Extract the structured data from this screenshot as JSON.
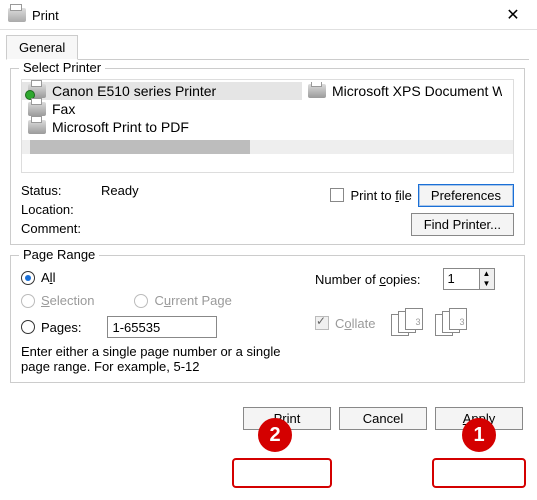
{
  "window": {
    "title": "Print"
  },
  "tabs": {
    "general": "General"
  },
  "select_printer": {
    "legend": "Select Printer",
    "items": [
      {
        "name": "Canon E510 series Printer",
        "default": true
      },
      {
        "name": "Fax",
        "default": false
      },
      {
        "name": "Microsoft Print to PDF",
        "default": false
      }
    ],
    "items_col2": [
      {
        "name": "Microsoft XPS Document W",
        "default": false
      }
    ]
  },
  "status": {
    "status_label": "Status:",
    "status_value": "Ready",
    "location_label": "Location:",
    "location_value": "",
    "comment_label": "Comment:",
    "comment_value": "",
    "print_to_file_prefix": "Print to ",
    "print_to_file_u": "f",
    "print_to_file_suffix": "ile",
    "preferences": "Preferences",
    "find_printer": "Find Printer..."
  },
  "page_range": {
    "legend": "Page Range",
    "all_u": "l",
    "all_prefix": "A",
    "all_suffix": "l",
    "selection_u": "S",
    "selection_suffix": "election",
    "current_u": "u",
    "current_prefix": "C",
    "current_suffix": "rrent Page",
    "pages_u": "g",
    "pages_prefix": "Pa",
    "pages_suffix": "es:",
    "pages_value": "1-65535",
    "hint": "Enter either a single page number or a single page range.  For example, 5-12"
  },
  "copies": {
    "label_prefix": "Number of ",
    "label_u": "c",
    "label_suffix": "opies:",
    "value": "1",
    "collate_u": "o",
    "collate_prefix": "C",
    "collate_suffix": "llate"
  },
  "footer": {
    "print_u": "P",
    "print_suffix": "rint",
    "cancel": "Cancel",
    "apply_u": "A",
    "apply_suffix": "pply"
  },
  "callouts": {
    "one": "1",
    "two": "2"
  }
}
